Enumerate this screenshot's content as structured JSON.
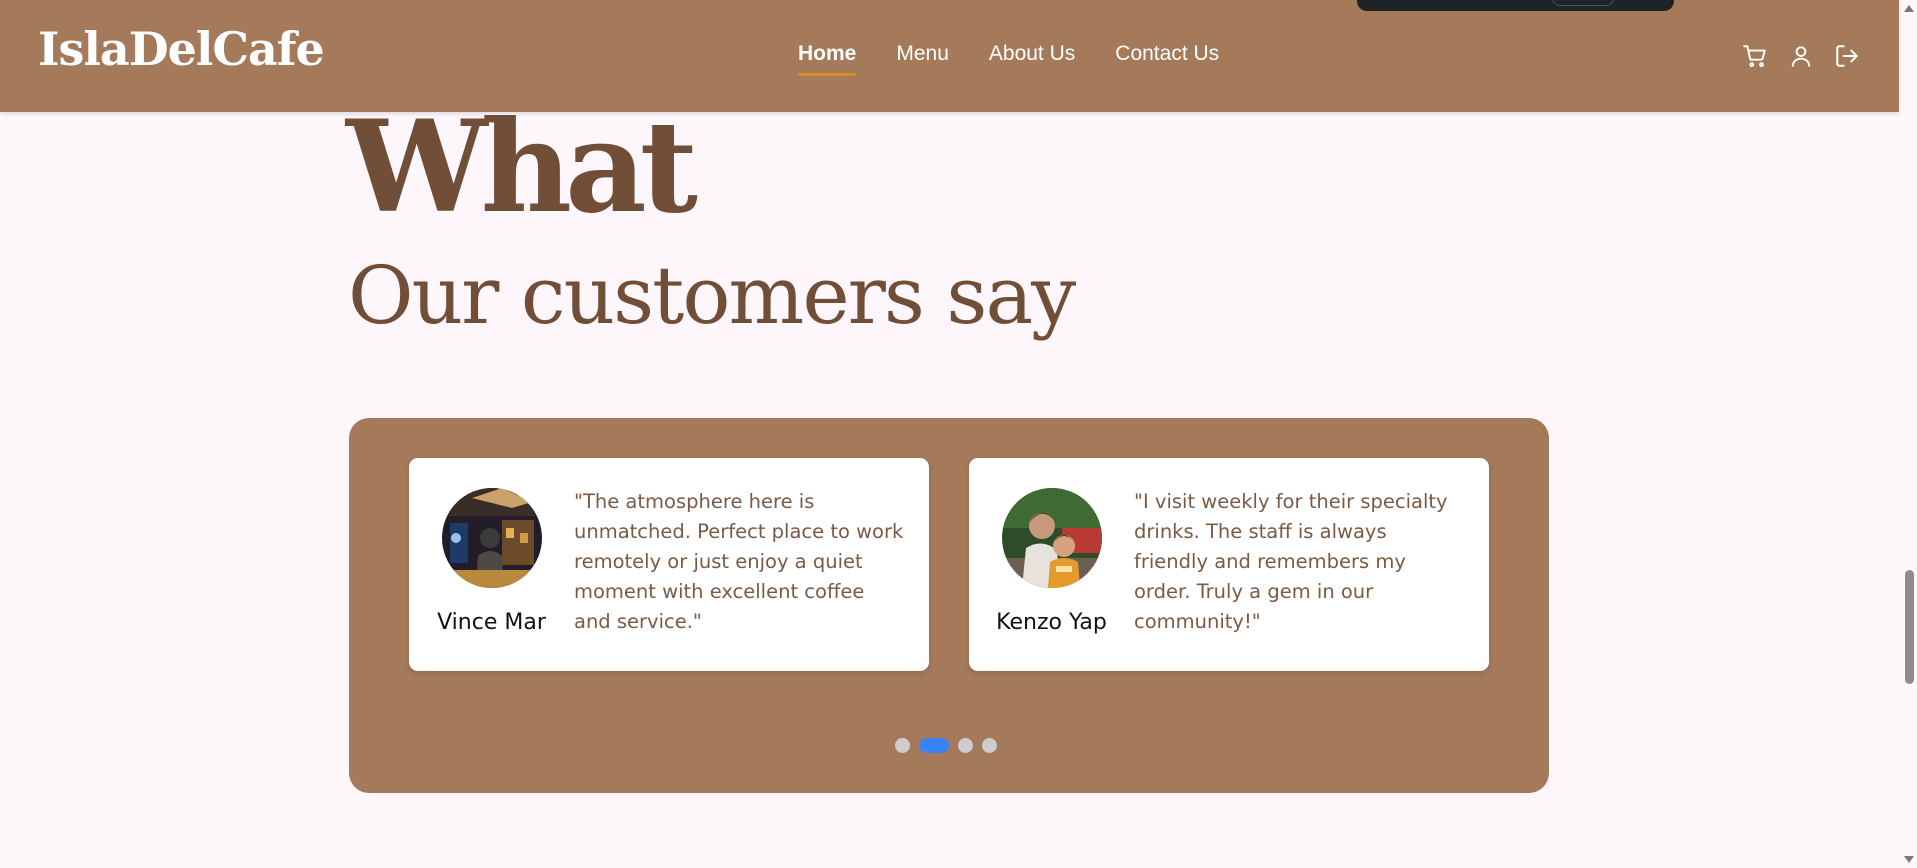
{
  "brand": {
    "name": "IslaDelCafe"
  },
  "nav": {
    "links": [
      {
        "label": "Home",
        "active": true
      },
      {
        "label": "Menu",
        "active": false
      },
      {
        "label": "About Us",
        "active": false
      },
      {
        "label": "Contact Us",
        "active": false
      }
    ],
    "icons": [
      "cart-icon",
      "user-icon",
      "logout-icon"
    ]
  },
  "section": {
    "headline": "What",
    "subheadline": "Our customers say"
  },
  "testimonials": [
    {
      "name": "Vince Mar",
      "quote": "\"The atmosphere here is unmatched. Perfect place to work remotely or just enjoy a quiet moment with excellent coffee and service.\""
    },
    {
      "name": "Kenzo Yap",
      "quote": "\"I visit weekly for their specialty drinks. The staff is always friendly and remembers my order. Truly a gem in our community!\""
    }
  ],
  "carousel": {
    "slide_count": 4,
    "active_index": 1
  },
  "colors": {
    "nav_bg": "#a57a5b",
    "page_bg": "#fdf7fb",
    "heading": "#714e38",
    "active_underline": "#d98a2a",
    "active_dot": "#3b82f6"
  }
}
